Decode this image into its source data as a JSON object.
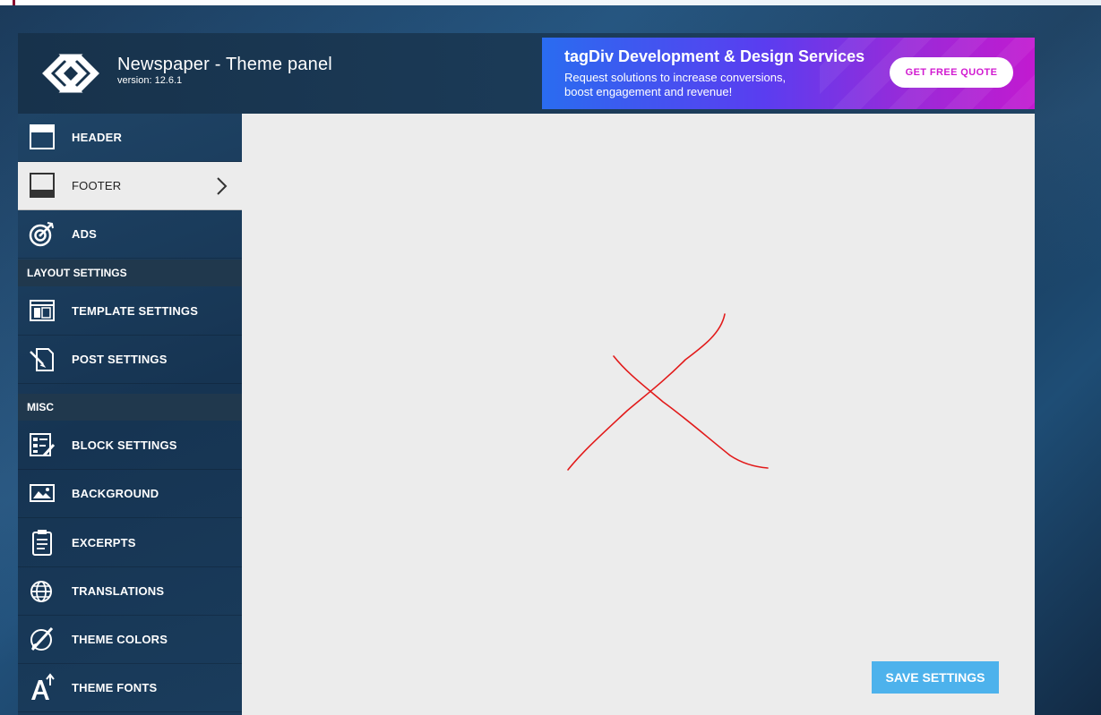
{
  "app": {
    "title": "Newspaper - Theme panel",
    "version": "version: 12.6.1"
  },
  "banner": {
    "title": "tagDiv Development & Design Services",
    "subtitle_line1": "Request solutions to increase conversions,",
    "subtitle_line2": "boost engagement and revenue!",
    "button_label": "GET FREE QUOTE",
    "gradient_colors": [
      "#2a6cf0",
      "#9a2ad8",
      "#c21ad0"
    ]
  },
  "sidebar": {
    "items": [
      {
        "label": "HEADER",
        "icon": "header-icon"
      },
      {
        "label": "FOOTER",
        "icon": "footer-icon",
        "active": true
      },
      {
        "label": "ADS",
        "icon": "target-icon"
      },
      {
        "label": "TEMPLATE SETTINGS",
        "icon": "template-icon"
      },
      {
        "label": "POST SETTINGS",
        "icon": "post-settings-icon"
      },
      {
        "label": "BLOCK SETTINGS",
        "icon": "block-settings-icon"
      },
      {
        "label": "BACKGROUND",
        "icon": "image-icon"
      },
      {
        "label": "EXCERPTS",
        "icon": "clipboard-icon"
      },
      {
        "label": "TRANSLATIONS",
        "icon": "globe-icon"
      },
      {
        "label": "THEME COLORS",
        "icon": "brush-icon"
      },
      {
        "label": "THEME FONTS",
        "icon": "font-icon"
      }
    ],
    "sections": {
      "layout": "LAYOUT SETTINGS",
      "misc": "MISC"
    }
  },
  "content": {
    "save_label": "SAVE SETTINGS",
    "annotation": "red-x-mark",
    "accent_color": "#4db2ec"
  }
}
